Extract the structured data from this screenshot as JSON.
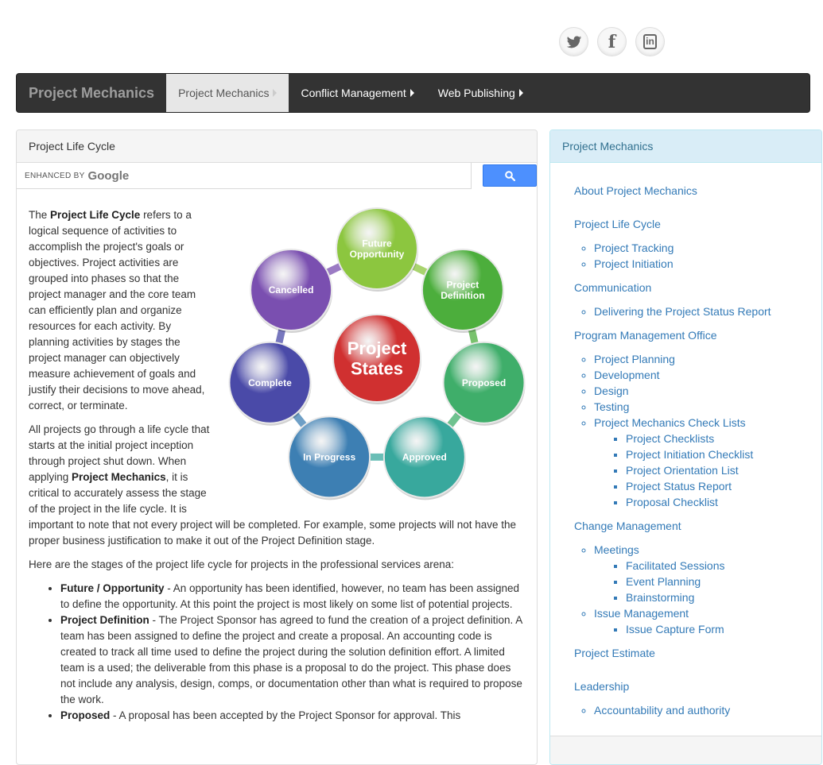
{
  "social": {
    "icons": [
      "twitter-icon",
      "facebook-icon",
      "linkedin-icon"
    ],
    "facebook_glyph": "f",
    "linkedin_glyph": "in"
  },
  "navbar": {
    "brand": "Project Mechanics",
    "items": [
      {
        "label": "Project Mechanics",
        "active": true
      },
      {
        "label": "Conflict Management",
        "active": false
      },
      {
        "label": "Web Publishing",
        "active": false
      }
    ]
  },
  "main": {
    "panel_title": "Project Life Cycle",
    "search": {
      "enhanced_by": "ENHANCED BY",
      "brand": "Google"
    },
    "diagram": {
      "center": [
        "Project",
        "States"
      ],
      "nodes": [
        {
          "label": [
            "Future",
            "Opportunity"
          ],
          "color": "#8cc63f"
        },
        {
          "label": [
            "Project",
            "Definition"
          ],
          "color": "#4cae3c"
        },
        {
          "label": [
            "Proposed"
          ],
          "color": "#3fae6a"
        },
        {
          "label": [
            "Approved"
          ],
          "color": "#38a89d"
        },
        {
          "label": [
            "In Progress"
          ],
          "color": "#3d7fb3"
        },
        {
          "label": [
            "Complete"
          ],
          "color": "#4a4aa8"
        },
        {
          "label": [
            "Cancelled"
          ],
          "color": "#7a4fb0"
        }
      ],
      "center_color": "#d03030"
    },
    "p1": {
      "t1": "The ",
      "b1": "Project Life Cycle",
      "t2": " refers to a logical sequence of activities to accomplish the project's goals or objectives. Project activities are grouped into phases so that the project manager and the core team can efficiently plan and organize resources for each activity.   By planning activities by stages the project manager can objectively measure achievement of goals and justify their decisions to move ahead, correct, or terminate."
    },
    "p2": {
      "t1": "All projects go through a life cycle that starts at the initial project inception through project shut down. When applying ",
      "b1": "Project Mechanics",
      "t2": ", it is critical to accurately assess the stage of the project in the life cycle. It is important to note that not every project will be completed. For example, some projects will not have the proper business justification to make it out of the Project Definition stage."
    },
    "p3": "Here are the stages of the project life cycle for projects in the professional services arena:",
    "stages": [
      {
        "name": "Future / Opportunity",
        "desc": " - An opportunity has been identified, however, no team has been assigned to define the opportunity.  At this point the project is most likely on some list of potential projects."
      },
      {
        "name": "Project Definition",
        "desc": " - The Project Sponsor has agreed to fund the creation of a project definition. A team has been assigned to define the project and create a proposal. An accounting code is created to track all time used to define the project during the solution definition effort. A limited team is a used; the deliverable from this phase is a proposal to do the project. This phase does not include any analysis, design, comps, or documentation other than what is required to propose the work."
      },
      {
        "name": "Proposed",
        "desc": " - A proposal has been accepted by the Project Sponsor for approval. This"
      }
    ]
  },
  "sidebar": {
    "title": "Project Mechanics",
    "about": "About Project Mechanics",
    "life_cycle": "Project Life Cycle",
    "life_cycle_items": [
      "Project Tracking",
      "Project Initiation"
    ],
    "communication": "Communication",
    "communication_items": [
      "Delivering the Project Status Report"
    ],
    "pmo": "Program Management Office",
    "pmo_items": [
      "Project Planning",
      "Development",
      "Design",
      "Testing",
      "Project Mechanics Check Lists"
    ],
    "checklist_items": [
      "Project Checklists",
      "Project Initiation Checklist",
      "Project Orientation List",
      "Project Status Report",
      "Proposal Checklist"
    ],
    "change": "Change Management",
    "meetings": "Meetings",
    "meetings_items": [
      "Facilitated Sessions",
      "Event Planning",
      "Brainstorming"
    ],
    "issue": "Issue Management",
    "issue_items": [
      "Issue Capture Form"
    ],
    "estimate": "Project Estimate",
    "leadership": "Leadership",
    "leadership_items": [
      "Accountability and authority"
    ]
  }
}
